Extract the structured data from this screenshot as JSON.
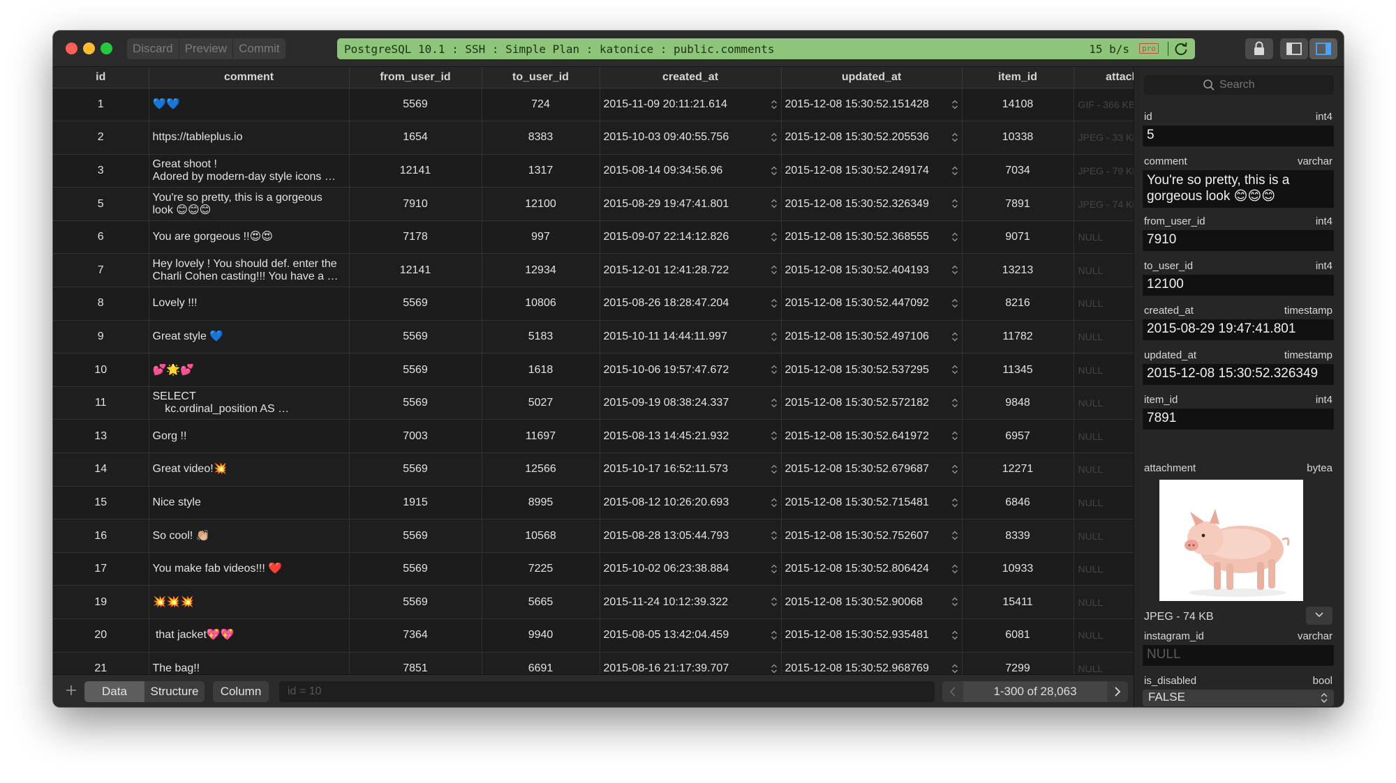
{
  "toolbar": {
    "discard_label": "Discard",
    "preview_label": "Preview",
    "commit_label": "Commit"
  },
  "connection": {
    "path": "PostgreSQL 10.1 : SSH : Simple Plan : katonice : public.comments",
    "speed": "15 b/s",
    "badge": "pro",
    "color": "#8fc57a"
  },
  "columns": [
    "id",
    "comment",
    "from_user_id",
    "to_user_id",
    "created_at",
    "updated_at",
    "item_id",
    "attachment"
  ],
  "rows": [
    {
      "id": "1",
      "comment": "💙💙",
      "from_user_id": "5569",
      "to_user_id": "724",
      "created_at": "2015-11-09 20:11:21.614",
      "updated_at": "2015-12-08 15:30:52.151428",
      "item_id": "14108",
      "attachment": "GIF - 366 KB"
    },
    {
      "id": "2",
      "comment": "https://tableplus.io",
      "from_user_id": "1654",
      "to_user_id": "8383",
      "created_at": "2015-10-03 09:40:55.756",
      "updated_at": "2015-12-08 15:30:52.205536",
      "item_id": "10338",
      "attachment": "JPEG - 33 KB"
    },
    {
      "id": "3",
      "comment": "Great shoot !\nAdored by modern-day style icons fro...",
      "from_user_id": "12141",
      "to_user_id": "1317",
      "created_at": "2015-08-14 09:34:56.96",
      "updated_at": "2015-12-08 15:30:52.249174",
      "item_id": "7034",
      "attachment": "JPEG - 79 KB"
    },
    {
      "id": "5",
      "comment": "You're so pretty, this is a gorgeous look 😊😊😊",
      "from_user_id": "7910",
      "to_user_id": "12100",
      "created_at": "2015-08-29 19:47:41.801",
      "updated_at": "2015-12-08 15:30:52.326349",
      "item_id": "7891",
      "attachment": "JPEG - 74 KB"
    },
    {
      "id": "6",
      "comment": "You are gorgeous !!😍😍",
      "from_user_id": "7178",
      "to_user_id": "997",
      "created_at": "2015-09-07 22:14:12.826",
      "updated_at": "2015-12-08 15:30:52.368555",
      "item_id": "9071",
      "attachment": "NULL"
    },
    {
      "id": "7",
      "comment": "Hey lovely ! You should def. enter the Charli Cohen casting!!! You have a gre...",
      "from_user_id": "12141",
      "to_user_id": "12934",
      "created_at": "2015-12-01 12:41:28.722",
      "updated_at": "2015-12-08 15:30:52.404193",
      "item_id": "13213",
      "attachment": "NULL"
    },
    {
      "id": "8",
      "comment": "Lovely !!!",
      "from_user_id": "5569",
      "to_user_id": "10806",
      "created_at": "2015-08-26 18:28:47.204",
      "updated_at": "2015-12-08 15:30:52.447092",
      "item_id": "8216",
      "attachment": "NULL"
    },
    {
      "id": "9",
      "comment": "Great style 💙",
      "from_user_id": "5569",
      "to_user_id": "5183",
      "created_at": "2015-10-11 14:44:11.997",
      "updated_at": "2015-12-08 15:30:52.497106",
      "item_id": "11782",
      "attachment": "NULL"
    },
    {
      "id": "10",
      "comment": "💕🌟💕",
      "from_user_id": "5569",
      "to_user_id": "1618",
      "created_at": "2015-10-06 19:57:47.672",
      "updated_at": "2015-12-08 15:30:52.537295",
      "item_id": "11345",
      "attachment": "NULL"
    },
    {
      "id": "11",
      "comment": "SELECT\n    kc.ordinal_position AS ordinal_posit...",
      "from_user_id": "5569",
      "to_user_id": "5027",
      "created_at": "2015-09-19 08:38:24.337",
      "updated_at": "2015-12-08 15:30:52.572182",
      "item_id": "9848",
      "attachment": "NULL"
    },
    {
      "id": "13",
      "comment": "Gorg !!",
      "from_user_id": "7003",
      "to_user_id": "11697",
      "created_at": "2015-08-13 14:45:21.932",
      "updated_at": "2015-12-08 15:30:52.641972",
      "item_id": "6957",
      "attachment": "NULL"
    },
    {
      "id": "14",
      "comment": "Great video!💥",
      "from_user_id": "5569",
      "to_user_id": "12566",
      "created_at": "2015-10-17 16:52:11.573",
      "updated_at": "2015-12-08 15:30:52.679687",
      "item_id": "12271",
      "attachment": "NULL"
    },
    {
      "id": "15",
      "comment": "Nice style",
      "from_user_id": "1915",
      "to_user_id": "8995",
      "created_at": "2015-08-12 10:26:20.693",
      "updated_at": "2015-12-08 15:30:52.715481",
      "item_id": "6846",
      "attachment": "NULL"
    },
    {
      "id": "16",
      "comment": "So cool! 👏🏼",
      "from_user_id": "5569",
      "to_user_id": "10568",
      "created_at": "2015-08-28 13:05:44.793",
      "updated_at": "2015-12-08 15:30:52.752607",
      "item_id": "8339",
      "attachment": "NULL"
    },
    {
      "id": "17",
      "comment": "You make fab videos!!! ❤️",
      "from_user_id": "5569",
      "to_user_id": "7225",
      "created_at": "2015-10-02 06:23:38.884",
      "updated_at": "2015-12-08 15:30:52.806424",
      "item_id": "10933",
      "attachment": "NULL"
    },
    {
      "id": "19",
      "comment": "💥💥💥",
      "from_user_id": "5569",
      "to_user_id": "5665",
      "created_at": "2015-11-24 10:12:39.322",
      "updated_at": "2015-12-08 15:30:52.90068",
      "item_id": "15411",
      "attachment": "NULL"
    },
    {
      "id": "20",
      "comment": " that jacket💖💖",
      "from_user_id": "7364",
      "to_user_id": "9940",
      "created_at": "2015-08-05 13:42:04.459",
      "updated_at": "2015-12-08 15:30:52.935481",
      "item_id": "6081",
      "attachment": "NULL"
    },
    {
      "id": "21",
      "comment": "The bag!!",
      "from_user_id": "7851",
      "to_user_id": "6691",
      "created_at": "2015-08-16 21:17:39.707",
      "updated_at": "2015-12-08 15:30:52.968769",
      "item_id": "7299",
      "attachment": "NULL"
    }
  ],
  "bottom": {
    "tab_data": "Data",
    "tab_structure": "Structure",
    "tab_column": "Column",
    "filter_placeholder": "id = 10",
    "page_label": "1-300 of 28,063"
  },
  "panel": {
    "search_placeholder": "Search",
    "fields": {
      "id": {
        "label": "id",
        "type": "int4",
        "value": "5"
      },
      "comment": {
        "label": "comment",
        "type": "varchar",
        "value": "You're so pretty, this is a gorgeous look 😊😊😊"
      },
      "from_user_id": {
        "label": "from_user_id",
        "type": "int4",
        "value": "7910"
      },
      "to_user_id": {
        "label": "to_user_id",
        "type": "int4",
        "value": "12100"
      },
      "created_at": {
        "label": "created_at",
        "type": "timestamp",
        "value": "2015-08-29 19:47:41.801"
      },
      "updated_at": {
        "label": "updated_at",
        "type": "timestamp",
        "value": "2015-12-08 15:30:52.326349"
      },
      "item_id": {
        "label": "item_id",
        "type": "int4",
        "value": "7891"
      },
      "attachment": {
        "label": "attachment",
        "type": "bytea",
        "value": "JPEG - 74 KB"
      },
      "instagram_id": {
        "label": "instagram_id",
        "type": "varchar",
        "value": "NULL"
      },
      "is_disabled": {
        "label": "is_disabled",
        "type": "bool",
        "value": "FALSE"
      }
    }
  }
}
